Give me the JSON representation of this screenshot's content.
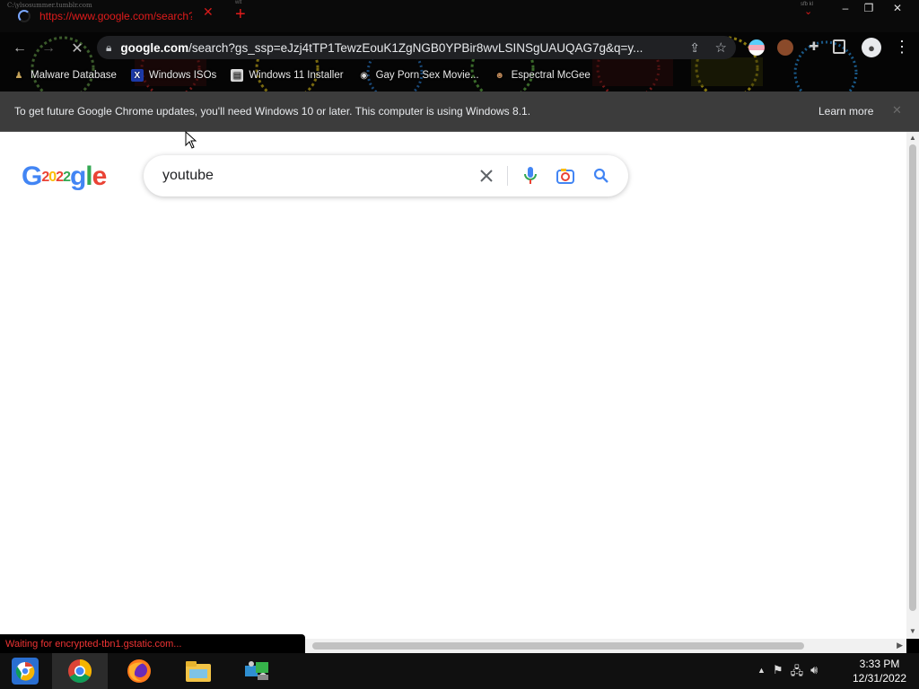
{
  "tab": {
    "title": "https://www.google.com/search?",
    "ghost_text": "C:\\ylsosummer.tumblr.com",
    "mini_text": "wlt",
    "mini_text2": "sfb kl"
  },
  "window_controls": {
    "minimize": "–",
    "maximize": "❐",
    "close": "✕"
  },
  "toolbar": {
    "url_domain": "google.com",
    "url_rest": "/search?gs_ssp=eJzj4tTP1TewzEouK1ZgNGB0YPBir8wvLSINSgUAUQAG7g&q=y..."
  },
  "bookmarks": [
    {
      "label": "Malware Database",
      "icon": "person-icon"
    },
    {
      "label": "Windows ISOs",
      "icon": "x-logo-icon"
    },
    {
      "label": "Windows 11 Installer",
      "icon": "page-icon"
    },
    {
      "label": "Gay Porn Sex Movie...",
      "icon": "globe-icon"
    },
    {
      "label": "Espectral McGee",
      "icon": "avatar-icon"
    }
  ],
  "infobar": {
    "message": "To get future Google Chrome updates, you'll need Windows 10 or later. This computer is using Windows 8.1.",
    "learn_more": "Learn more",
    "close": "✕"
  },
  "page": {
    "logo_letters": [
      "G",
      "2",
      "0",
      "2",
      "2",
      "g",
      "l",
      "e"
    ],
    "search_value": "youtube"
  },
  "status": {
    "text": "Waiting for encrypted-tbn1.gstatic.com..."
  },
  "clock": {
    "time": "3:33 PM",
    "date": "12/31/2022"
  }
}
